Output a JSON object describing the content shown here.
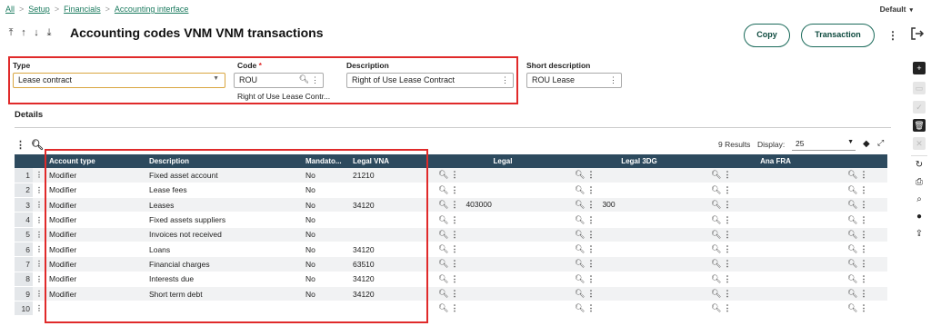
{
  "breadcrumb": {
    "home": "All",
    "items": [
      "Setup",
      "Financials",
      "Accounting interface"
    ]
  },
  "default_menu": "Default",
  "title": "Accounting codes VNM VNM transactions",
  "buttons": {
    "copy": "Copy",
    "transaction": "Transaction"
  },
  "form": {
    "type_label": "Type",
    "type_value": "Lease contract",
    "code_label": "Code",
    "code_required": "*",
    "code_value": "ROU",
    "code_desc": "Right of Use Lease Contr...",
    "description_label": "Description",
    "description_value": "Right of Use Lease Contract",
    "short_label": "Short description",
    "short_value": "ROU Lease"
  },
  "details_title": "Details",
  "results": {
    "text": "9 Results",
    "display_label": "Display:",
    "display_value": "25"
  },
  "columns": [
    "Account type",
    "Description",
    "Mandato...",
    "Legal VNA",
    "Legal",
    "Legal 3DG",
    "Ana FRA"
  ],
  "rows": [
    {
      "num": "1",
      "account_type": "Modifier",
      "description": "Fixed asset account",
      "mandatory": "No",
      "legal_vna": "21210",
      "legal": "",
      "legal_3dg": ""
    },
    {
      "num": "2",
      "account_type": "Modifier",
      "description": "Lease fees",
      "mandatory": "No",
      "legal_vna": "",
      "legal": "",
      "legal_3dg": ""
    },
    {
      "num": "3",
      "account_type": "Modifier",
      "description": "Leases",
      "mandatory": "No",
      "legal_vna": "34120",
      "legal": "403000",
      "legal_3dg": "300"
    },
    {
      "num": "4",
      "account_type": "Modifier",
      "description": "Fixed assets suppliers",
      "mandatory": "No",
      "legal_vna": "",
      "legal": "",
      "legal_3dg": ""
    },
    {
      "num": "5",
      "account_type": "Modifier",
      "description": "Invoices not received",
      "mandatory": "No",
      "legal_vna": "",
      "legal": "",
      "legal_3dg": ""
    },
    {
      "num": "6",
      "account_type": "Modifier",
      "description": "Loans",
      "mandatory": "No",
      "legal_vna": "34120",
      "legal": "",
      "legal_3dg": ""
    },
    {
      "num": "7",
      "account_type": "Modifier",
      "description": "Financial charges",
      "mandatory": "No",
      "legal_vna": "63510",
      "legal": "",
      "legal_3dg": ""
    },
    {
      "num": "8",
      "account_type": "Modifier",
      "description": "Interests due",
      "mandatory": "No",
      "legal_vna": "34120",
      "legal": "",
      "legal_3dg": ""
    },
    {
      "num": "9",
      "account_type": "Modifier",
      "description": "Short term debt",
      "mandatory": "No",
      "legal_vna": "34120",
      "legal": "",
      "legal_3dg": ""
    },
    {
      "num": "10",
      "account_type": "",
      "description": "",
      "mandatory": "",
      "legal_vna": "",
      "legal": "",
      "legal_3dg": ""
    }
  ],
  "side_icons": [
    "plus-icon",
    "form-icon",
    "check-icon",
    "trash-icon",
    "close-icon",
    "refresh-icon",
    "print-icon",
    "attachment-icon",
    "comment-icon",
    "share-icon"
  ],
  "colors": {
    "accent": "#1a6a5a",
    "header_bg": "#2d4a5e",
    "highlight": "#e02a2a",
    "focus": "#d9a640"
  }
}
